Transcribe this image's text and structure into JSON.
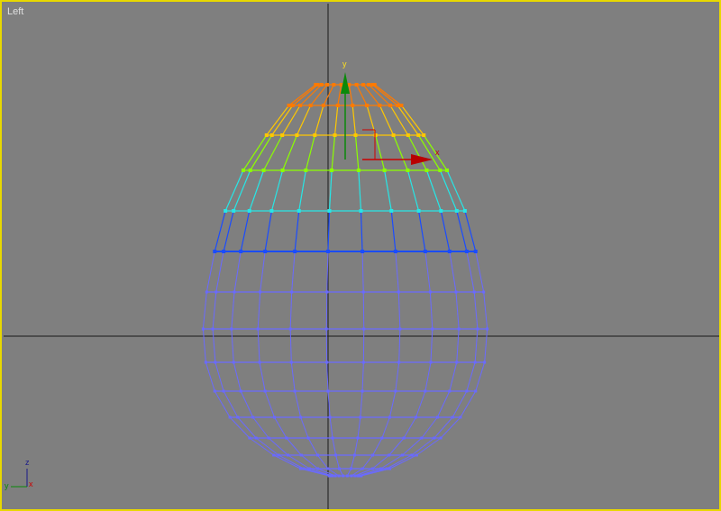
{
  "viewport": {
    "label": "Left",
    "border_color": "#e8d800",
    "background": "#7f7f7f"
  },
  "gizmo": {
    "x_label": "x",
    "y_label": "y",
    "x_color": "#cc0000",
    "y_color": "#0a8a0a"
  },
  "axis_tripod": {
    "z_label": "z",
    "y_label": "y",
    "x_label": "x"
  },
  "soft_selection_colors": [
    "#ff7a00",
    "#ff9a00",
    "#ffc800",
    "#8cff00",
    "#27e6e6",
    "#1a4cff",
    "#6a6aff"
  ]
}
